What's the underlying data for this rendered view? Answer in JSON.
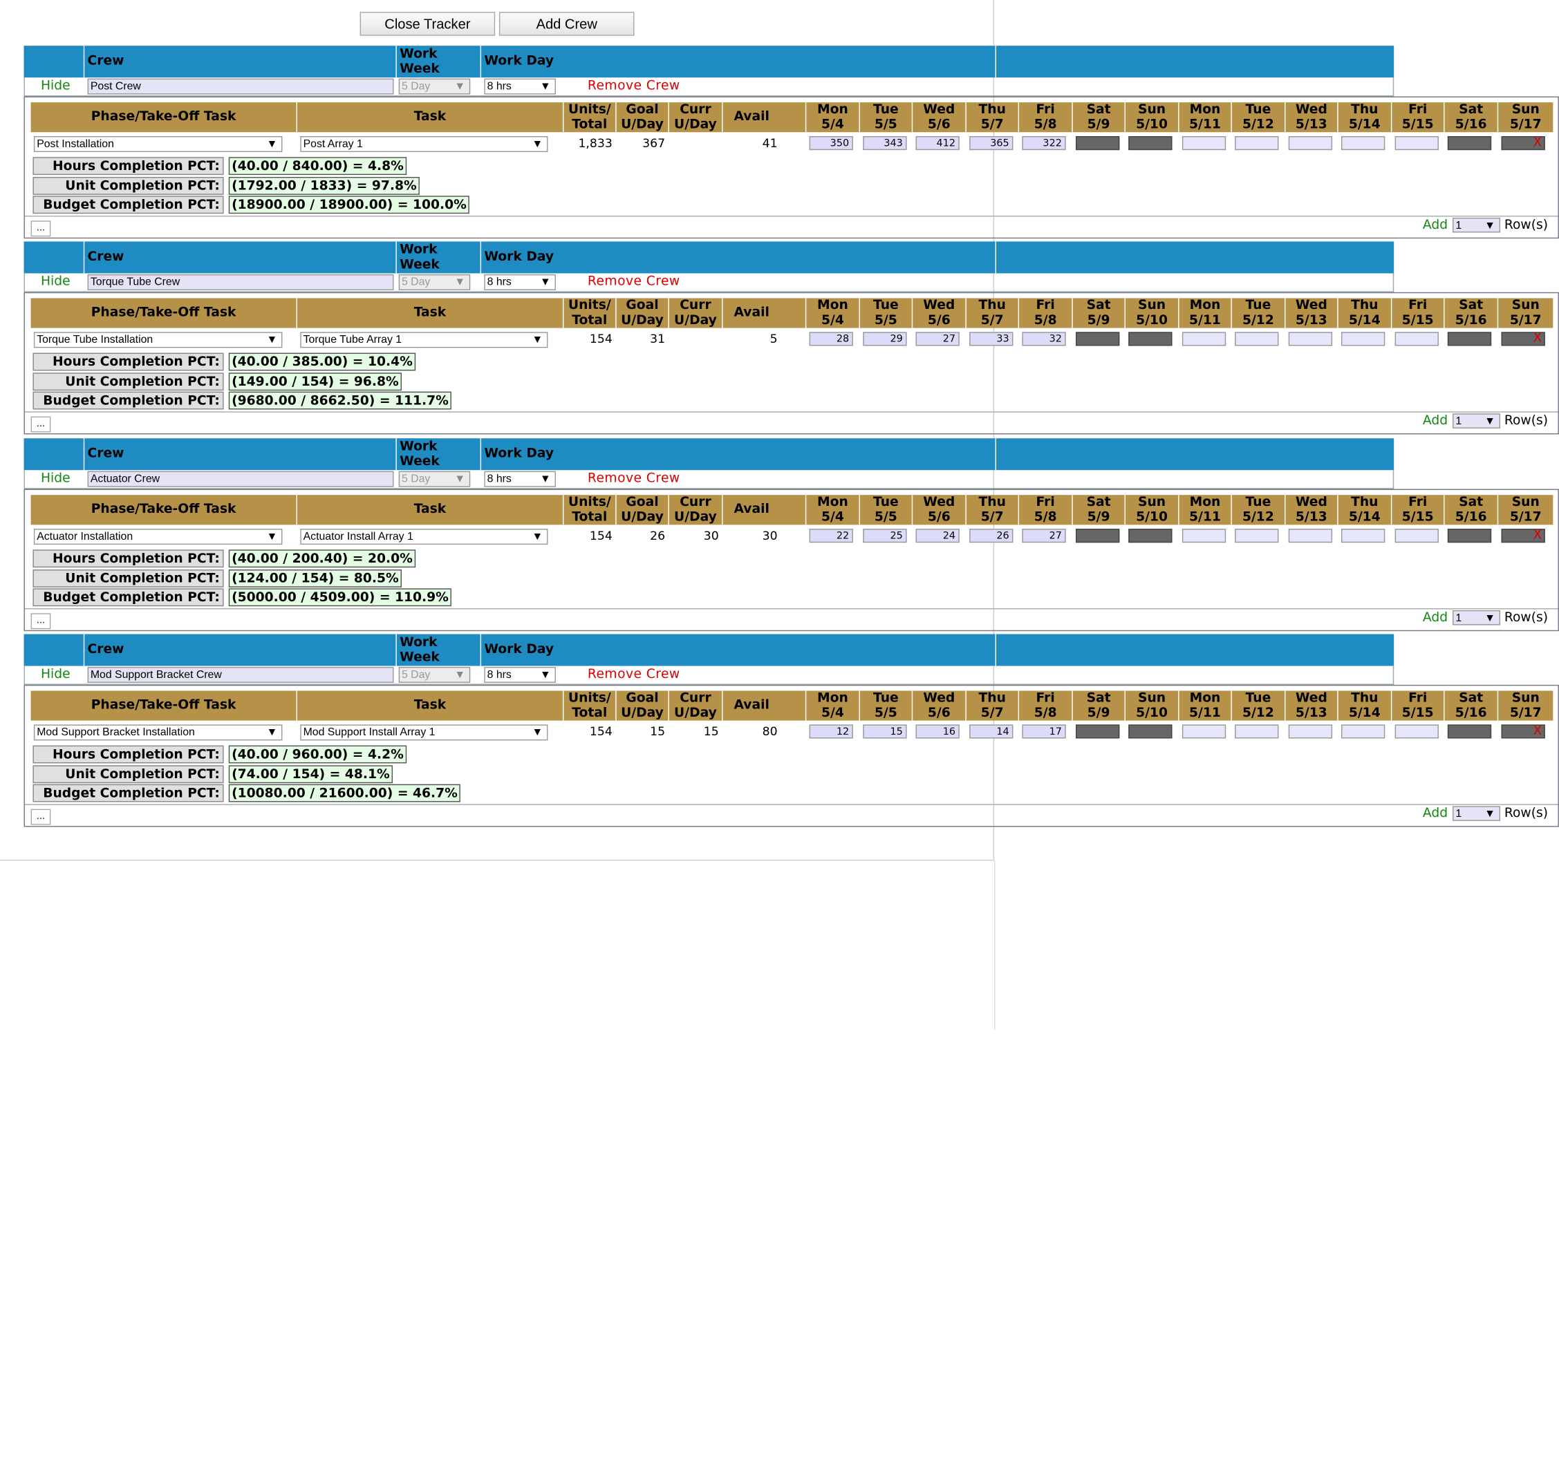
{
  "toolbar": {
    "close_label": "Close Tracker",
    "add_crew_label": "Add Crew"
  },
  "colors": {
    "crew_header": "#1e8bc3",
    "task_header": "#b59248",
    "pct_value_bg": "#e4fbe4",
    "link_green": "#118811",
    "link_red": "#dd0000"
  },
  "crew_header": {
    "crew": "Crew",
    "work_week": "Work Week",
    "work_day": "Work Day"
  },
  "crew_labels": {
    "hide": "Hide",
    "remove": "Remove Crew",
    "x": "X",
    "add": "Add",
    "add_count": "1",
    "rows": "Row(s)",
    "dots": "..."
  },
  "task_header": {
    "phase": "Phase/Take-Off Task",
    "task": "Task",
    "units": "Units/ Total",
    "goal": "Goal U/Day",
    "curr": "Curr U/Day",
    "avail": "Avail"
  },
  "days": [
    {
      "d": "Mon",
      "n": "5/4"
    },
    {
      "d": "Tue",
      "n": "5/5"
    },
    {
      "d": "Wed",
      "n": "5/6"
    },
    {
      "d": "Thu",
      "n": "5/7"
    },
    {
      "d": "Fri",
      "n": "5/8"
    },
    {
      "d": "Sat",
      "n": "5/9"
    },
    {
      "d": "Sun",
      "n": "5/10"
    },
    {
      "d": "Mon",
      "n": "5/11"
    },
    {
      "d": "Tue",
      "n": "5/12"
    },
    {
      "d": "Wed",
      "n": "5/13"
    },
    {
      "d": "Thu",
      "n": "5/14"
    },
    {
      "d": "Fri",
      "n": "5/15"
    },
    {
      "d": "Sat",
      "n": "5/16"
    },
    {
      "d": "Sun",
      "n": "5/17"
    }
  ],
  "pct_labels": {
    "hours": "Hours Completion PCT:",
    "unit": "Unit Completion PCT:",
    "budget": "Budget Completion PCT:"
  },
  "crews": [
    {
      "name": "Post Crew",
      "work_week": "5 Day",
      "work_day": "8 hrs",
      "phase": "Post Installation",
      "task": "Post Array 1",
      "units": "1,833",
      "goal": "367",
      "curr": "",
      "avail": "41",
      "daily": [
        "350",
        "343",
        "412",
        "365",
        "322"
      ],
      "hours_pct": "(40.00 / 840.00) = 4.8%",
      "unit_pct": "(1792.00 / 1833) = 97.8%",
      "budget_pct": "(18900.00 / 18900.00) = 100.0%"
    },
    {
      "name": "Torque Tube Crew",
      "work_week": "5 Day",
      "work_day": "8 hrs",
      "phase": "Torque Tube Installation",
      "task": "Torque Tube Array 1",
      "units": "154",
      "goal": "31",
      "curr": "",
      "avail": "5",
      "daily": [
        "28",
        "29",
        "27",
        "33",
        "32"
      ],
      "hours_pct": "(40.00 / 385.00) = 10.4%",
      "unit_pct": "(149.00 / 154) = 96.8%",
      "budget_pct": "(9680.00 / 8662.50) = 111.7%"
    },
    {
      "name": "Actuator Crew",
      "work_week": "5 Day",
      "work_day": "8 hrs",
      "phase": "Actuator Installation",
      "task": "Actuator Install Array 1",
      "units": "154",
      "goal": "26",
      "curr": "30",
      "avail": "30",
      "daily": [
        "22",
        "25",
        "24",
        "26",
        "27"
      ],
      "hours_pct": "(40.00 / 200.40) = 20.0%",
      "unit_pct": "(124.00 / 154) = 80.5%",
      "budget_pct": "(5000.00 / 4509.00) = 110.9%"
    },
    {
      "name": "Mod Support Bracket Crew",
      "work_week": "5 Day",
      "work_day": "8 hrs",
      "phase": "Mod Support Bracket Installation",
      "task": "Mod Support Install Array 1",
      "units": "154",
      "goal": "15",
      "curr": "15",
      "avail": "80",
      "daily": [
        "12",
        "15",
        "16",
        "14",
        "17"
      ],
      "hours_pct": "(40.00 / 960.00) = 4.2%",
      "unit_pct": "(74.00 / 154) = 48.1%",
      "budget_pct": "(10080.00 / 21600.00) = 46.7%"
    }
  ]
}
